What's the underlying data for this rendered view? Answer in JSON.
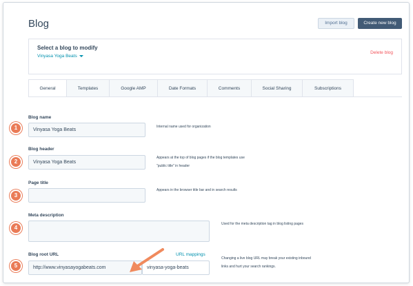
{
  "header": {
    "title": "Blog",
    "import_label": "Import blog",
    "create_label": "Create new blog"
  },
  "select_blog": {
    "title": "Select a blog to modify",
    "value": "Vinyasa Yoga Beats",
    "delete_label": "Delete blog"
  },
  "tabs": [
    {
      "label": "General"
    },
    {
      "label": "Templates"
    },
    {
      "label": "Google AMP"
    },
    {
      "label": "Date Formats"
    },
    {
      "label": "Comments"
    },
    {
      "label": "Social Sharing"
    },
    {
      "label": "Subscriptions"
    }
  ],
  "fields": {
    "blog_name": {
      "badge": "1",
      "label": "Blog name",
      "value": "Vinyasa Yoga Beats",
      "help": "Internal name used for organization"
    },
    "blog_header": {
      "badge": "2",
      "label": "Blog header",
      "value": "Vinyasa Yoga Beats",
      "help_line1": "Appears at the top of blog pages if the blog templates use",
      "help_line2": "\"public title\" in header"
    },
    "page_title": {
      "badge": "3",
      "label": "Page title",
      "value": "",
      "help": "Appears in the browser title bar and in search results"
    },
    "meta_description": {
      "badge": "4",
      "label": "Meta description",
      "value": "",
      "help": "Used for the meta description tag in blog listing pages"
    },
    "blog_root_url": {
      "badge": "5",
      "label": "Blog root URL",
      "mappings_link": "URL mappings",
      "domain": "http://www.vinyasayogabeats.com",
      "slug": "vinyasa-yoga-beats",
      "help_line1": "Changing a live blog URL may break your existing inbound",
      "help_line2": "links and hurt your search rankings."
    }
  },
  "colors": {
    "accent": "#0091ae",
    "primary_button": "#425b76",
    "danger": "#f2545b",
    "badge": "#ea7b57",
    "arrow": "#f08a5d"
  }
}
